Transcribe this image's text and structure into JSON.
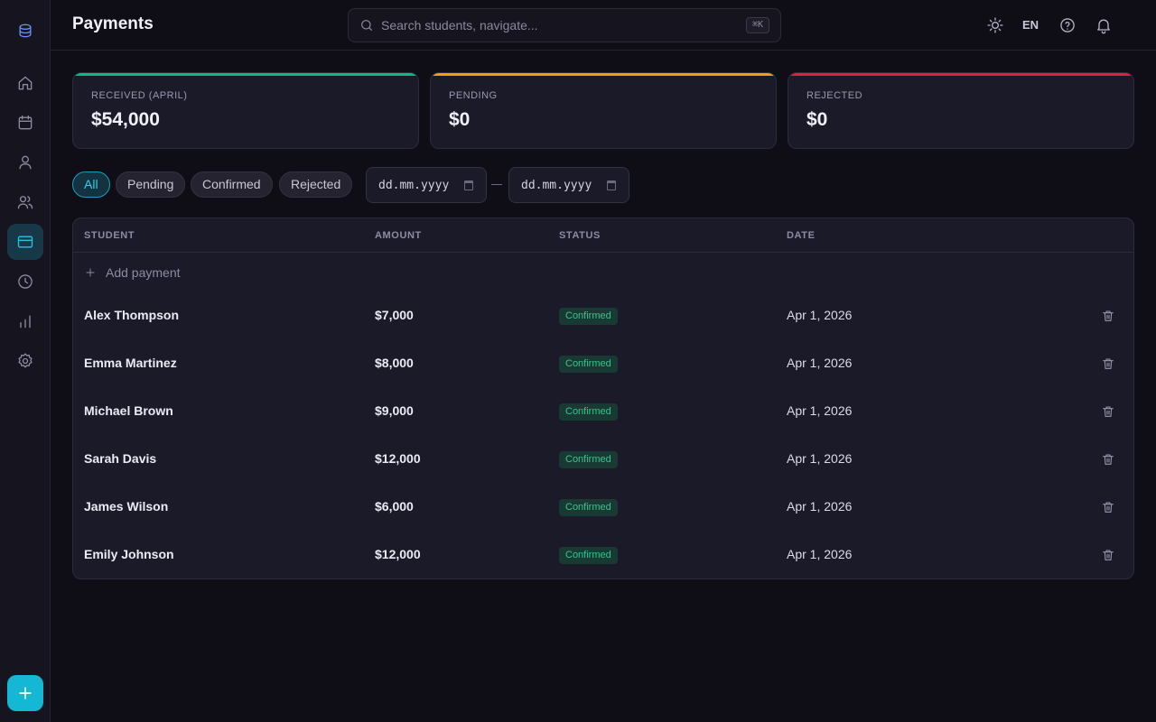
{
  "header": {
    "title": "Payments",
    "search_placeholder": "Search students, navigate...",
    "search_shortcut": "⌘K",
    "language": "EN"
  },
  "sidebar": {
    "items": [
      {
        "name": "dashboard",
        "icon": "home-icon"
      },
      {
        "name": "calendar",
        "icon": "calendar-icon"
      },
      {
        "name": "students",
        "icon": "user-icon"
      },
      {
        "name": "groups",
        "icon": "users-icon"
      },
      {
        "name": "payments",
        "icon": "credit-card-icon",
        "active": true
      },
      {
        "name": "history",
        "icon": "clock-icon"
      },
      {
        "name": "analytics",
        "icon": "bar-chart-icon"
      },
      {
        "name": "settings",
        "icon": "gear-icon"
      }
    ]
  },
  "stats": [
    {
      "label": "RECEIVED (APRIL)",
      "value": "$54,000",
      "accent": "#10b981"
    },
    {
      "label": "PENDING",
      "value": "$0",
      "accent": "#f59e0b"
    },
    {
      "label": "REJECTED",
      "value": "$0",
      "accent": "#e11d48"
    }
  ],
  "filters": {
    "chips": [
      "All",
      "Pending",
      "Confirmed",
      "Rejected"
    ],
    "active": "All",
    "date_from_placeholder": "dd.mm.yyyy",
    "date_to_placeholder": "dd.mm.yyyy"
  },
  "table": {
    "columns": [
      "STUDENT",
      "AMOUNT",
      "STATUS",
      "DATE"
    ],
    "add_label": "Add payment",
    "rows": [
      {
        "student": "Alex Thompson",
        "amount": "$7,000",
        "status": "Confirmed",
        "date": "Apr 1, 2026"
      },
      {
        "student": "Emma Martinez",
        "amount": "$8,000",
        "status": "Confirmed",
        "date": "Apr 1, 2026"
      },
      {
        "student": "Michael Brown",
        "amount": "$9,000",
        "status": "Confirmed",
        "date": "Apr 1, 2026"
      },
      {
        "student": "Sarah Davis",
        "amount": "$12,000",
        "status": "Confirmed",
        "date": "Apr 1, 2026"
      },
      {
        "student": "James Wilson",
        "amount": "$6,000",
        "status": "Confirmed",
        "date": "Apr 1, 2026"
      },
      {
        "student": "Emily Johnson",
        "amount": "$12,000",
        "status": "Confirmed",
        "date": "Apr 1, 2026"
      }
    ]
  },
  "colors": {
    "accent": "#14b8d4",
    "confirmed": "#35c48f"
  }
}
